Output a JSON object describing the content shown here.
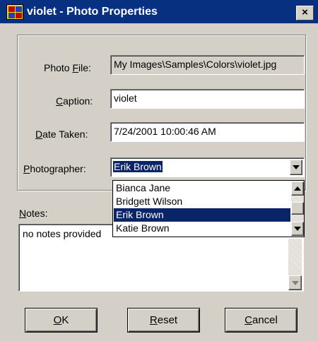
{
  "window": {
    "title": "violet - Photo Properties",
    "close_label": "×",
    "icon": "app-grid-icon"
  },
  "form": {
    "photo_file": {
      "label_pre": "Photo ",
      "label_ul": "F",
      "label_post": "ile:",
      "value": "My Images\\Samples\\Colors\\violet.jpg"
    },
    "caption": {
      "label_pre": "",
      "label_ul": "C",
      "label_post": "aption:",
      "value": "violet"
    },
    "date_taken": {
      "label_pre": "",
      "label_ul": "D",
      "label_post": "ate Taken:",
      "value": "7/24/2001 10:00:46 AM"
    },
    "photographer": {
      "label_pre": "",
      "label_ul": "P",
      "label_post": "hotographer:",
      "value": "Erik Brown",
      "options": [
        "Bianca Jane",
        "Bridgett Wilson",
        "Erik Brown",
        "Katie Brown"
      ],
      "selected_index": 2
    }
  },
  "notes": {
    "label_ul": "N",
    "label_post": "otes:",
    "value": "no notes provided"
  },
  "buttons": {
    "ok": {
      "ul": "O",
      "rest": "K"
    },
    "reset": {
      "ul": "R",
      "rest": "eset"
    },
    "cancel": {
      "ul": "C",
      "rest": "ancel"
    }
  },
  "colors": {
    "titlebar": "#083081",
    "selection": "#0a246a",
    "face": "#d4d0c8"
  }
}
